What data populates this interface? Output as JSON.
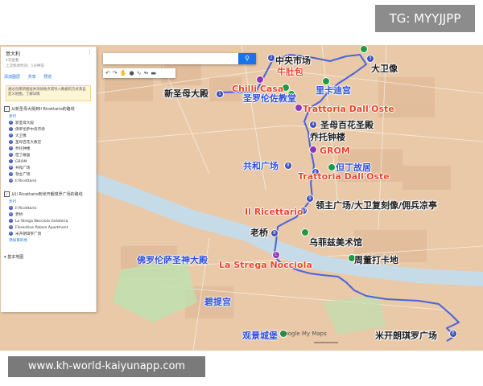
{
  "watermark_top": "TG: MYYJJPP",
  "watermark_bottom": "www.kh-world-kaiyunapp.com",
  "panel": {
    "title": "意大利",
    "subtitle": "1次查看",
    "updated": "上次修改时间：1分钟前",
    "actions": [
      "添加图层",
      "共享",
      "预览"
    ],
    "notice": "通过创建新图层并添加地点或导入数据的方式来自定义地图。了解详情",
    "layer1": {
      "title": "从新圣母大殿到Il Ricettario的路线",
      "mode": "步行",
      "items": [
        "新圣母大殿",
        "佛罗伦萨中央市场",
        "大卫像",
        "圣母百花大教堂",
        "乔托钟楼",
        "但丁故居",
        "GROM",
        "共和广场",
        "领主广场",
        "Il Ricettario"
      ]
    },
    "layer2": {
      "title": "从Il Ricettario到米开朗琪罗广场的路线",
      "mode": "步行",
      "items": [
        "Il Ricettario",
        "老桥",
        "La Strega Nocciola Gelateria",
        "Florentine Palace Apartment",
        "米开朗琪罗广场"
      ],
      "add": "添加目的地"
    },
    "basemap": "基本地图"
  },
  "toolbar_icons": [
    "undo-icon",
    "redo-icon",
    "hand-icon",
    "marker-icon",
    "line-icon",
    "route-icon",
    "ruler-icon"
  ],
  "labels": {
    "central_market": "中央市场",
    "beef": "牛肚包",
    "david": "大卫像",
    "santa_maria_novella": "新圣母大殿",
    "chilli_casa": "Chilli Casa",
    "san_lorenzo": "圣罗伦佐教堂",
    "riccardi": "里卡迪宫",
    "trattoria1": "Trattoria Dall'Oste",
    "duomo": "圣母百花圣殿",
    "giotto": "乔托钟楼",
    "grom": "GROM",
    "republic": "共和广场",
    "dante": "但丁故居",
    "trattoria2": "Trattoria Dall'Oste",
    "il_ricettario": "Il Ricettario",
    "signoria": "领主广场/大卫复刻像/佣兵凉亭",
    "ponte_vecchio": "老桥",
    "uffizi": "乌菲兹美术馆",
    "santo_spirito": "佛罗伦萨圣神大殿",
    "strega": "La Strega Nocciola",
    "checkin": "周董打卡地",
    "pitti": "碧提宫",
    "belvedere": "观景城堡",
    "michelangelo": "米开朗琪罗广场"
  },
  "map_credit": "Google My Maps",
  "colors": {
    "route": "#4a63d9",
    "river": "#c6dbe8",
    "land": "#e9c9a8"
  }
}
